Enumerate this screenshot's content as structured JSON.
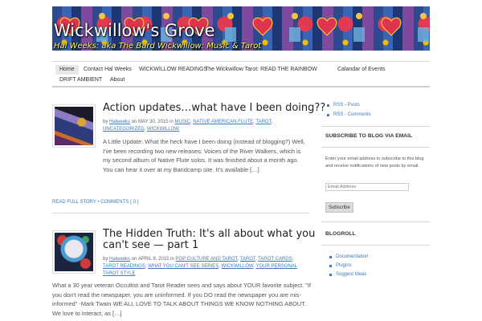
{
  "header": {
    "site_title": "Wickwillow's Grove",
    "tagline": "Hal Weeks: aka The Bard Wickwillow: Music & Tarot"
  },
  "nav": {
    "items": [
      {
        "label": "Home",
        "active": true
      },
      {
        "label": "Contact Hal Weeks"
      },
      {
        "label": "WICKWILLOW READINGS"
      },
      {
        "label": "The Wickwillow Tarot: READ THE RAINBOW"
      },
      {
        "label": "Calandar of Events"
      },
      {
        "label": "DRIFT AMBIENT"
      },
      {
        "label": "About"
      }
    ]
  },
  "posts": [
    {
      "title": "Action updates…what have I been doing??",
      "meta": {
        "by": "by",
        "author": "Halweeks",
        "on": "on MAY 30, 2015 in",
        "categories": [
          "MUSIC",
          "NATIVE AMERICAN FLUTE",
          "TAROT",
          "UNCATEGORIZED",
          "WICKWILLOW"
        ]
      },
      "excerpt": "A Little Update: What the heck have I been doing (instead of blogging?) Well, I've been recording two new releases: Voices of the River Walkers, which is my second album of Native Flute solos.   It was finished about a month ago.   You can hear it over at my Bandcamp site.    It's available […]",
      "read_full": "READ FULL STORY",
      "comments": "COMMENTS { 0 }"
    },
    {
      "title_line1": "The Hidden Truth: It's all about what you",
      "title_line2": "can't see — part 1",
      "meta": {
        "by": "by",
        "author": "Halweeks",
        "on": "on APRIL 8, 2015 in",
        "categories": [
          "POP CULTURE AND TAROT",
          "TAROT",
          "TAROT CARDS",
          "TAROT READINGS",
          "WHAT YOU CAN'T SEE SERIES",
          "WICKWILLOW",
          "YOUR PERSONAL TAROT STYLE"
        ]
      },
      "excerpt": "What a 30 year veteran Occultist and Tarot Reader sees and says about YOUR favorite subject.      \"If you don't read the newspaper, you are uninformed. If you DO read the newspaper you are mis-informed\" -Mark Twain   WE ALL LOVE TO TALK ABOUT THINGS WE KNOW NOTHING ABOUT. We love to interact, as […]"
    }
  ],
  "sidebar": {
    "rss_posts": "RSS - Posts",
    "rss_comments": "RSS - Comments",
    "subscribe_heading": "SUBSCRIBE TO BLOG VIA EMAIL",
    "subscribe_text": "Enter your email address to subscribe to this blog and receive notifications of new posts by email.",
    "email_placeholder": "Email Address",
    "subscribe_button": "Subscribe",
    "blogroll_heading": "BLOGROLL",
    "blogroll_links": [
      "Documentation",
      "Plugins",
      "Suggest Ideas"
    ]
  }
}
